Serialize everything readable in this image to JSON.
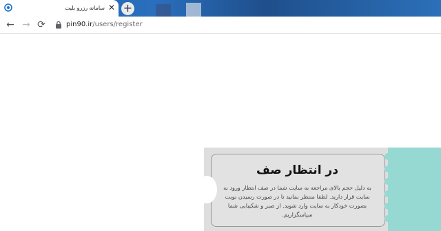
{
  "browser": {
    "tab": {
      "title": "سامانه رزرو بلیت",
      "close_glyph": "✕",
      "favicon": "site-favicon-icon"
    },
    "new_tab_glyph": "+",
    "nav": {
      "back_glyph": "←",
      "forward_glyph": "→",
      "reload_glyph": "⟳"
    },
    "address": {
      "host": "pin90.ir",
      "path": "/users/register"
    }
  },
  "page": {
    "queue_card": {
      "title": "در انتظار صف",
      "message": "به دلیل حجم بالای مراجعه به سایت شما در صف انتظار ورود به سایت قرار دارید. لطفا منتظر بمانید تا در صورت رسیدن نوبت بصورت خودکار به سایت وارد شوید. از صبر و شکیبایی شما سپاسگزاریم."
    }
  },
  "colors": {
    "accent_teal": "#96d9d3",
    "card_bg": "#e2e2e2",
    "tabbar_blue": "#2a6fbd"
  }
}
